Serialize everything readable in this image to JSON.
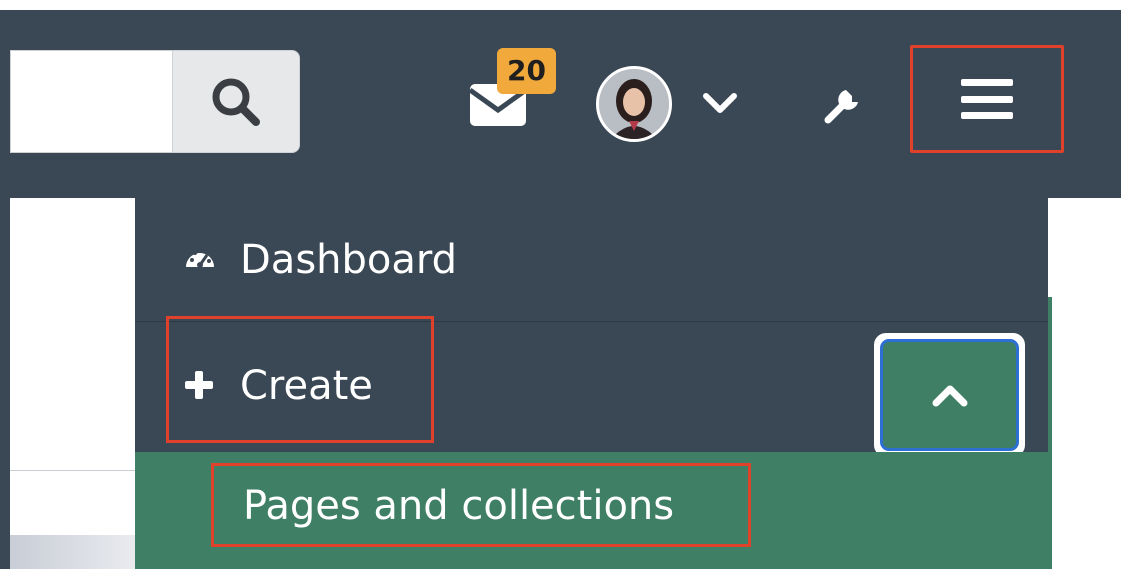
{
  "navbar": {
    "search": {
      "value": "",
      "placeholder": "",
      "button_icon": "search-icon"
    },
    "notifications": {
      "icon": "envelope-icon",
      "badge_count": "20"
    },
    "user": {
      "avatar_icon": "user-avatar",
      "menu_icon": "chevron-down-icon"
    },
    "admin": {
      "icon": "wrench-icon"
    },
    "menu_toggle": {
      "icon": "hamburger-icon"
    }
  },
  "dropdown": {
    "items": [
      {
        "label": "Dashboard",
        "icon": "dashboard-gauge-icon"
      },
      {
        "label": "Create",
        "icon": "plus-icon",
        "expanded": true,
        "toggle_icon": "chevron-up-icon"
      }
    ],
    "submenu": [
      {
        "label": "Pages and collections"
      }
    ]
  },
  "colors": {
    "navbar_bg": "#3a4754",
    "submenu_bg": "#3f7f65",
    "badge_bg": "#f0a93a",
    "highlight_border": "#e0412a",
    "focus_border": "#2e6fd4"
  }
}
